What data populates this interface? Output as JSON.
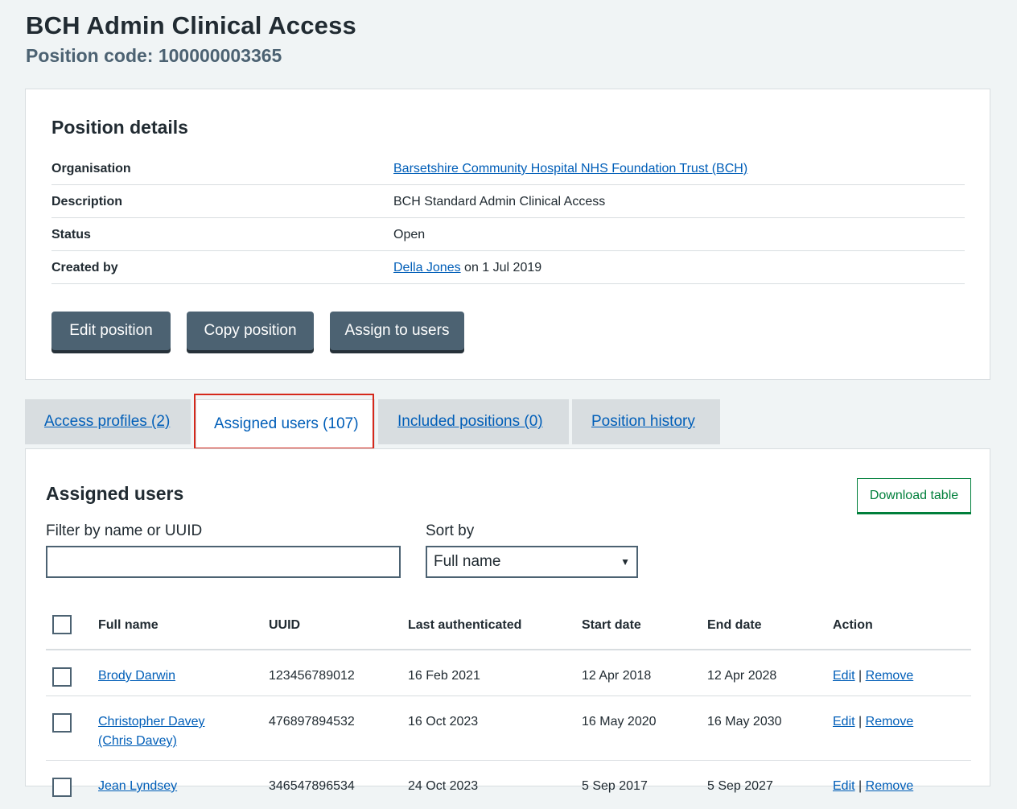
{
  "header": {
    "title": "BCH Admin Clinical Access",
    "position_code": "Position code: 100000003365"
  },
  "details": {
    "heading": "Position details",
    "rows": [
      {
        "key": "Organisation",
        "value": "Barsetshire Community Hospital NHS Foundation Trust (BCH)"
      },
      {
        "key": "Description",
        "value": "BCH Standard Admin Clinical Access"
      },
      {
        "key": "Status",
        "value": "Open"
      },
      {
        "key": "Created by",
        "link": "Della Jones",
        "suffix": " on 1 Jul 2019"
      }
    ],
    "buttons": {
      "edit": "Edit position",
      "copy": "Copy position",
      "assign": "Assign to users"
    }
  },
  "tabs": [
    {
      "label": "Access profiles (2)"
    },
    {
      "label": "Assigned users (107)"
    },
    {
      "label": "Included positions (0)"
    },
    {
      "label": "Position history"
    }
  ],
  "users": {
    "heading": "Assigned users",
    "download_label": "Download table",
    "filter_label": "Filter by name or UUID",
    "filter_value": "",
    "sort_label": "Sort by",
    "sort_value": "Full name",
    "columns": [
      "Full name",
      "UUID",
      "Last authenticated",
      "Start date",
      "End date",
      "Action"
    ],
    "action_edit": "Edit",
    "action_sep": "|",
    "action_remove": "Remove",
    "rows": [
      {
        "name": "Brody Darwin",
        "uuid": "123456789012",
        "last_auth": "16 Feb 2021",
        "start": "12 Apr 2018",
        "end": "12 Apr 2028"
      },
      {
        "name": "Christopher Davey",
        "name2": "(Chris Davey)",
        "uuid": "476897894532",
        "last_auth": "16 Oct 2023",
        "start": "16 May 2020",
        "end": "16 May 2030"
      },
      {
        "name": "Jean Lyndsey",
        "uuid": "346547896534",
        "last_auth": "24 Oct 2023",
        "start": "5 Sep 2017",
        "end": "5 Sep 2027"
      }
    ]
  },
  "colors": {
    "page_bg": "#f0f4f5",
    "link": "#005eb8",
    "button": "#4c6272",
    "download": "#007f3b",
    "highlight": "#d5281b"
  }
}
